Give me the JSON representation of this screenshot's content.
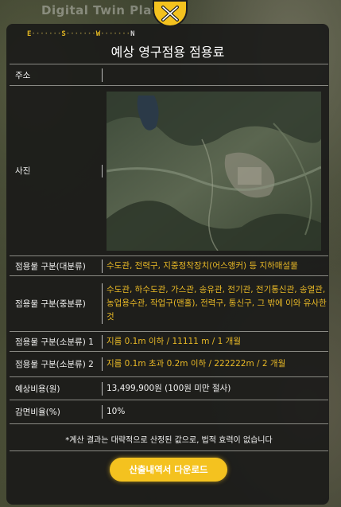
{
  "background": {
    "brand_text": "Digital Twin Platfo"
  },
  "compass": {
    "letters": [
      "E",
      "S",
      "W",
      "N"
    ]
  },
  "dialog": {
    "title": "예상 영구점용 점용료",
    "rows": [
      {
        "label": "주소",
        "value": ""
      },
      {
        "label": "사진",
        "value": ""
      },
      {
        "label": "점용물 구분(대분류)",
        "value": "수도관, 전력구, 지중정착장치(어스앵커) 등 지하매설물"
      },
      {
        "label": "점용물 구분(중분류)",
        "value": "수도관, 하수도관, 가스관, 송유관, 전기관, 전기통신관, 송열관, 농업용수관, 작업구(맨홀), 전력구, 통신구, 그 밖에 이와 유사한 것"
      },
      {
        "label": "점용물 구분(소분류) 1",
        "value": "지름 0.1m 이하 / 11111 m / 1 개월"
      },
      {
        "label": "점용물 구분(소분류) 2",
        "value": "지름 0.1m 초과 0.2m 이하 / 222222m / 2 개월"
      },
      {
        "label": "예상비용(원)",
        "value": "13,499,900원 (100원 미만 절사)"
      },
      {
        "label": "감면비율(%)",
        "value": "10%"
      }
    ],
    "note": "*계산 결과는 대략적으로 산정된 값으로, 법적 효력이 없습니다",
    "download_label": "산출내역서 다운로드"
  },
  "colors": {
    "accent": "#f4c21f",
    "value_highlight": "#e9b926"
  },
  "icons": {
    "close": "close-icon"
  }
}
